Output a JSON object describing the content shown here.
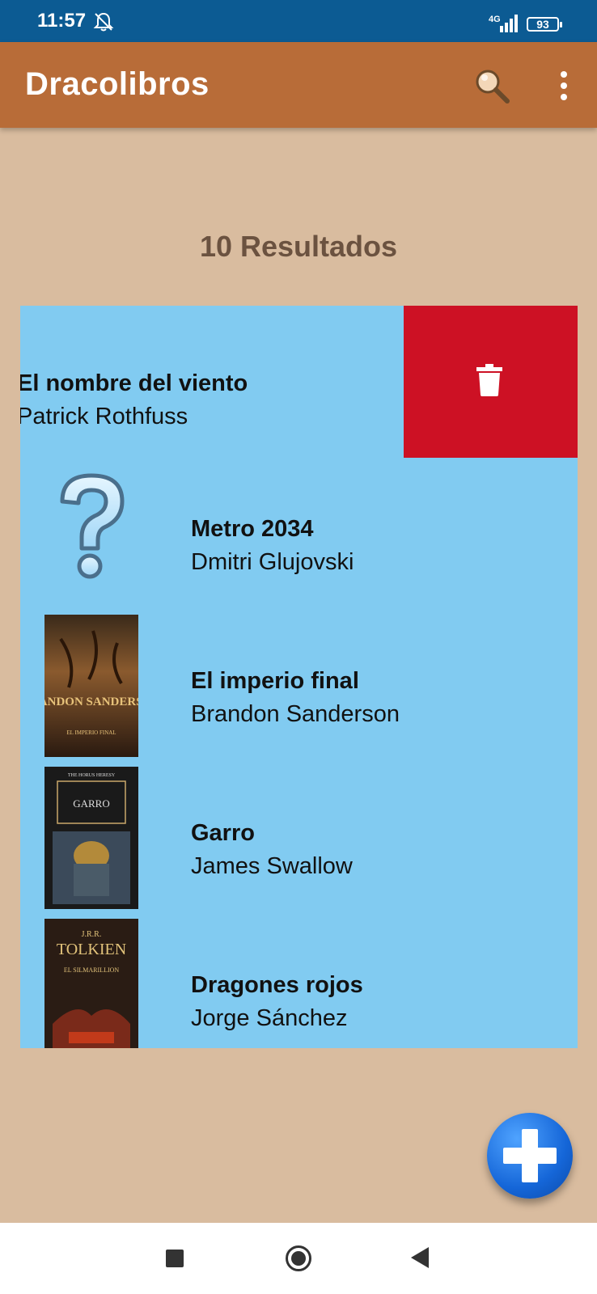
{
  "status_bar": {
    "time": "11:57",
    "network": "4G",
    "battery": "93",
    "icons": [
      "bell-muted-icon",
      "signal-icon",
      "battery-icon"
    ]
  },
  "app_bar": {
    "title": "Dracolibros",
    "background_color": "#b86c38",
    "icons": [
      "search-icon",
      "more-vert-icon"
    ]
  },
  "results_label": "10 Resultados",
  "list": {
    "background_color": "#81cbf1",
    "delete_color": "#cd1124",
    "books": [
      {
        "title": "El nombre del viento",
        "author": "Patrick Rothfuss",
        "state": "swiped",
        "cover": "none"
      },
      {
        "title": "Metro 2034",
        "author": "Dmitri Glujovski",
        "cover": "question-mark-placeholder"
      },
      {
        "title": "El imperio final",
        "author": "Brandon Sanderson",
        "cover": "book-cover",
        "cover_text": "BRANDON SANDERSON",
        "cover_subtext": "EL IMPERIO FINAL"
      },
      {
        "title": "Garro",
        "author": "James Swallow",
        "cover": "book-cover",
        "cover_text": "GARRO",
        "cover_subtext": "THE HORUS HERESY"
      },
      {
        "title": "Dragones rojos",
        "author": "Jorge Sánchez",
        "cover": "book-cover",
        "cover_text": "TOLKIEN",
        "cover_subtext": "EL SILMARILLION",
        "cover_top": "J.R.R."
      }
    ]
  },
  "fab": {
    "icon": "plus-icon"
  },
  "nav_bar": {
    "icons": [
      "recents-icon",
      "home-icon",
      "back-icon"
    ]
  }
}
